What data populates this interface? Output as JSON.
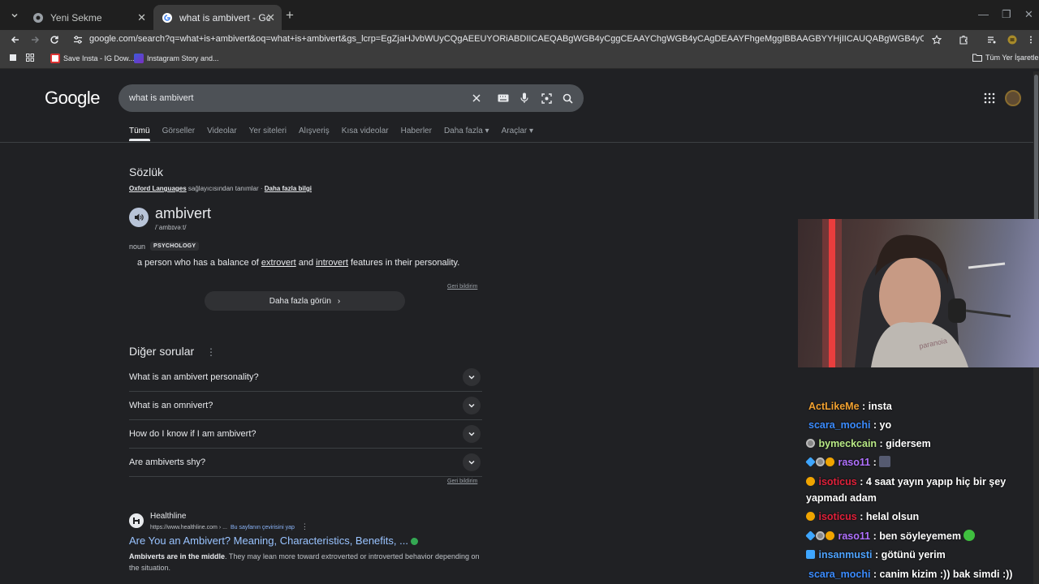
{
  "browser": {
    "tabs": [
      {
        "title": "Yeni Sekme"
      },
      {
        "title": "what is ambivert - Google'da A"
      }
    ],
    "url": "google.com/search?q=what+is+ambivert&oq=what+is+ambivert&gs_lcrp=EgZjaHJvbWUyCQgAEEUYORiABDIICAEQABgWGB4yCggCEAAYChgWGB4yCAgDEAAYFhgeMggIBBAAGBYYHjIICAUQABgWGB4yCAgGEAAYFhgeMggIBxAAGBYYHjIICAgQABgWGB4yCAgJEAAYFhge",
    "bookmarks": [
      {
        "label": "Save Insta - IG Dow..."
      },
      {
        "label": "Instagram Story and..."
      }
    ],
    "all_bookmarks": "Tüm Yer İşaretleri"
  },
  "google": {
    "logo": "Google",
    "query": "what is ambivert",
    "tabs": [
      "Tümü",
      "Görseller",
      "Videolar",
      "Yer siteleri",
      "Alışveriş",
      "Kısa videolar",
      "Haberler",
      "Daha fazla",
      "Araçlar"
    ]
  },
  "dictionary": {
    "title": "Sözlük",
    "source_name": "Oxford Languages",
    "source_suffix": " sağlayıcısından tanımlar · ",
    "source_more": "Daha fazla bilgi",
    "word": "ambivert",
    "phonetic": "/ˈambɪvəːt/",
    "pos": "noun",
    "tag": "PSYCHOLOGY",
    "def_part1": "a person who has a balance of ",
    "def_link1": "extrovert",
    "def_part2": " and ",
    "def_link2": "introvert",
    "def_part3": " features in their personality.",
    "feedback": "Geri bildirim",
    "more_button": "Daha fazla görün"
  },
  "other_questions": {
    "title": "Diğer sorular",
    "items": [
      "What is an ambivert personality?",
      "What is an omnivert?",
      "How do I know if I am ambivert?",
      "Are ambiverts shy?"
    ],
    "feedback": "Geri bildirim"
  },
  "result": {
    "site": "Healthline",
    "url": "https://www.healthline.com › ...",
    "translate": "Bu sayfanın çevirisini yap",
    "title": "Are You an Ambivert? Meaning, Characteristics, Benefits, ...",
    "snippet_bold": "Ambiverts are in the middle",
    "snippet_rest": ". They may lean more toward extroverted or introverted behavior depending on the situation."
  },
  "chat": [
    {
      "user": "ActLikeMe",
      "color": "#f0a030",
      "text": " : insta"
    },
    {
      "user": "scara_mochi",
      "color": "#3b8cff",
      "text": " : yo"
    },
    {
      "user": "bymeckcain",
      "color": "#b8e986",
      "text": " : gidersem"
    },
    {
      "user": "raso11",
      "color": "#b071ff",
      "text": " : "
    },
    {
      "user": "isoticus",
      "color": "#e0203a",
      "text": " : 4 saat yayın yapıp hiç bir şey yapmadı adam"
    },
    {
      "user": "isoticus",
      "color": "#e0203a",
      "text": " : helal olsun"
    },
    {
      "user": "raso11",
      "color": "#b071ff",
      "text": " : ben söyleyemem"
    },
    {
      "user": "insanmusti",
      "color": "#4ea3ff",
      "text": " : götünü yerim"
    },
    {
      "user": "scara_mochi",
      "color": "#3b8cff",
      "text": " : canim kizim :)) bak simdi :))"
    }
  ]
}
